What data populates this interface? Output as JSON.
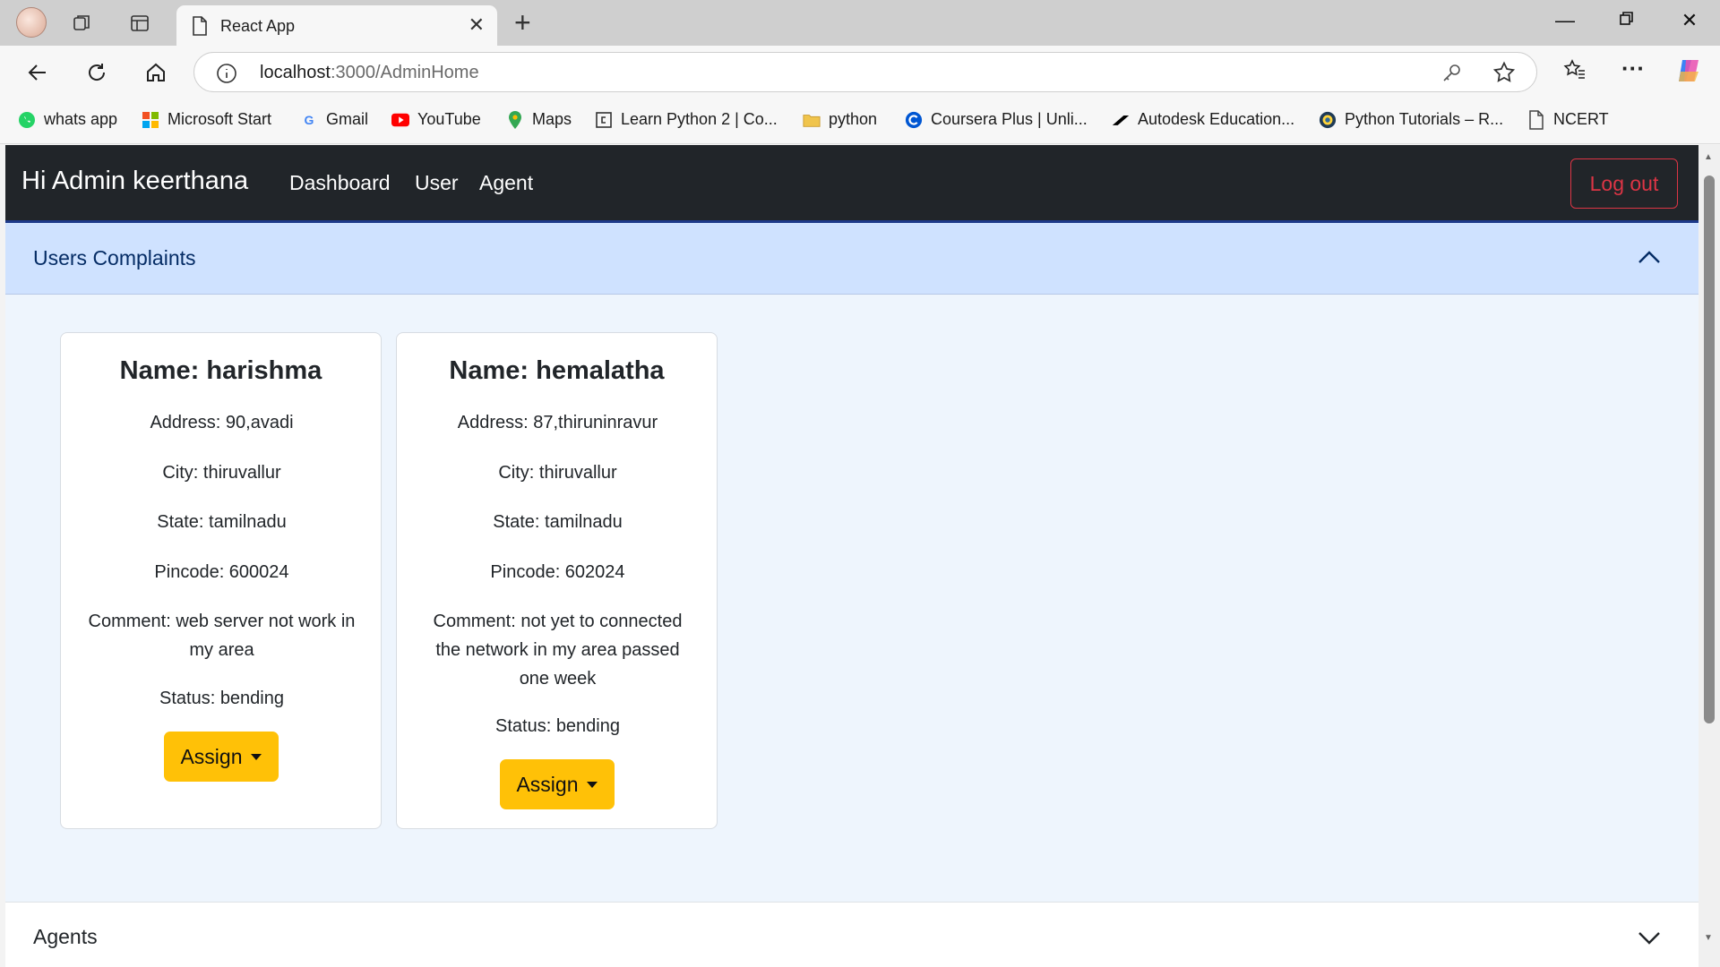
{
  "browser": {
    "tab_title": "React App",
    "url_host": "localhost",
    "url_path": ":3000/AdminHome",
    "bookmarks": [
      {
        "label": "whats app",
        "icon": "whatsapp-icon",
        "color": "#25d366"
      },
      {
        "label": "Microsoft Start",
        "icon": "microsoft-icon",
        "color": "#f25022"
      },
      {
        "label": "Gmail",
        "icon": "google-icon",
        "color": "#4285f4"
      },
      {
        "label": "YouTube",
        "icon": "youtube-icon",
        "color": "#ff0000"
      },
      {
        "label": "Maps",
        "icon": "maps-icon",
        "color": "#34a853"
      },
      {
        "label": "Learn Python 2 | Co...",
        "icon": "codecademy-icon",
        "color": "#333333"
      },
      {
        "label": "python",
        "icon": "folder-icon",
        "color": "#e8b84a"
      },
      {
        "label": "Coursera Plus | Unli...",
        "icon": "coursera-icon",
        "color": "#0056d2"
      },
      {
        "label": "Autodesk Education...",
        "icon": "autodesk-icon",
        "color": "#000000"
      },
      {
        "label": "Python Tutorials – R...",
        "icon": "realpython-icon",
        "color": "#1f3b57"
      },
      {
        "label": "NCERT",
        "icon": "page-icon",
        "color": "#444444"
      }
    ]
  },
  "app": {
    "brand": "Hi Admin keerthana",
    "nav": [
      "Dashboard",
      "User",
      "Agent"
    ],
    "logout_label": "Log out",
    "section_complaints": "Users Complaints",
    "section_agents": "Agents",
    "assign_label": "Assign",
    "complaints": [
      {
        "name": "Name: harishma",
        "address": "Address: 90,avadi",
        "city": "City: thiruvallur",
        "state": "State: tamilnadu",
        "pincode": "Pincode: 600024",
        "comment": "Comment: web server not work in my area",
        "status": "Status: bending"
      },
      {
        "name": "Name: hemalatha",
        "address": "Address: 87,thiruninravur",
        "city": "City: thiruvallur",
        "state": "State: tamilnadu",
        "pincode": "Pincode: 602024",
        "comment": "Comment: not yet to connected the network in my area passed one week",
        "status": "Status: bending"
      }
    ]
  },
  "colors": {
    "navbar": "#212529",
    "accordion_active": "#cfe2ff",
    "assign_button": "#ffc107",
    "logout_outline": "#dc3545"
  }
}
